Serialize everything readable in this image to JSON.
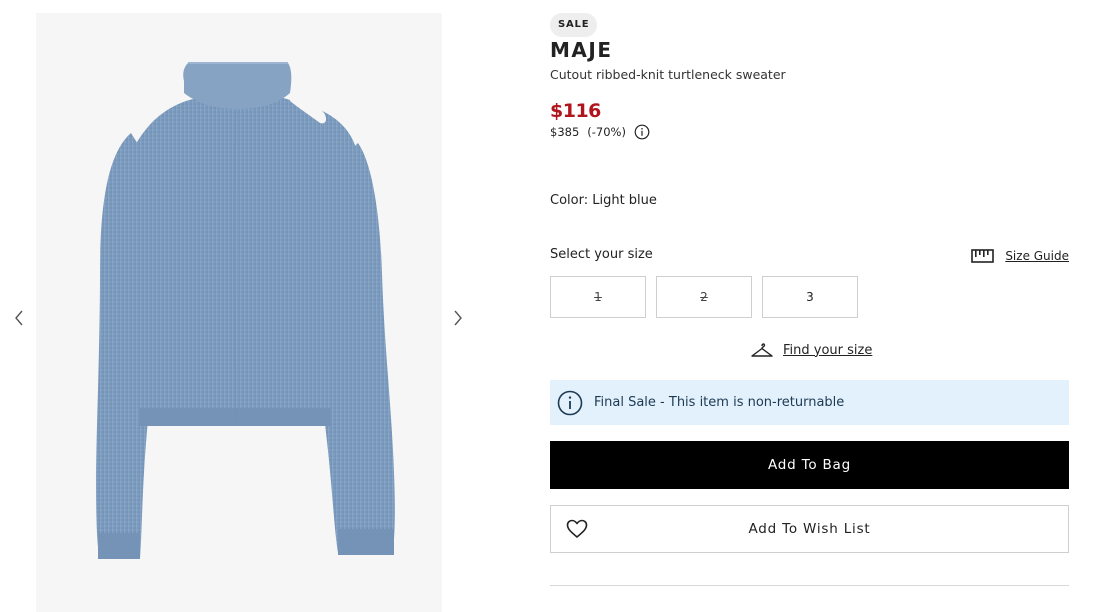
{
  "gallery": {
    "image_description": "sweater-image",
    "prev_icon": "chevron-left-icon",
    "next_icon": "chevron-right-icon"
  },
  "product": {
    "badge": "SALE",
    "brand": "MAJE",
    "name": "Cutout ribbed-knit turtleneck sweater",
    "sale_price": "$116",
    "original_price": "$385",
    "discount": "(-70%)",
    "price_info_icon": "info-icon",
    "color_label": "Color:",
    "color_value": "Light blue"
  },
  "size": {
    "label": "Select your size",
    "guide_label": "Size Guide",
    "guide_icon": "ruler-icon",
    "options": [
      {
        "label": "1",
        "available": false
      },
      {
        "label": "2",
        "available": false
      },
      {
        "label": "3",
        "available": true
      }
    ],
    "find_label": "Find your size",
    "find_icon": "hanger-icon"
  },
  "notice": {
    "icon": "info-icon",
    "text": "Final Sale - This item is non-returnable"
  },
  "actions": {
    "add_to_bag": "Add To Bag",
    "add_to_wish_list": "Add To Wish List",
    "wish_icon": "heart-icon"
  },
  "colors": {
    "sale_price": "#b0141c",
    "notice_bg": "#e2f1fb",
    "primary_button": "#000000",
    "sweater": "#7c9bbf"
  }
}
